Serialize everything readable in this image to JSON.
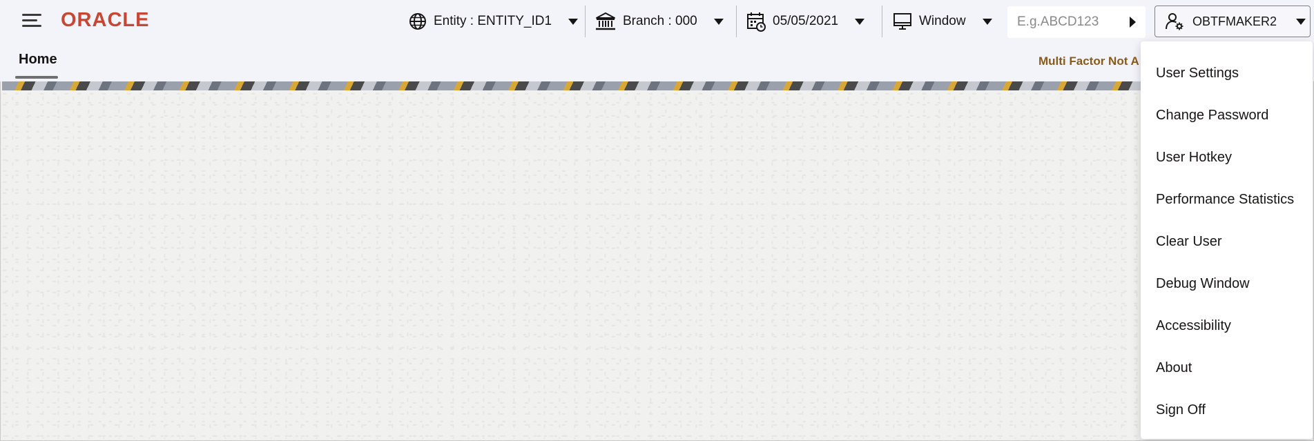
{
  "header": {
    "logo_text": "ORACLE",
    "entity_label": "Entity : ENTITY_ID1",
    "branch_label": "Branch : 000",
    "date_label": "05/05/2021",
    "window_label": "Window",
    "search_placeholder": "E.g.ABCD123",
    "user_label": "OBTFMAKER2"
  },
  "tabs": {
    "home_label": "Home",
    "mfa_notice": "Multi Factor Not A"
  },
  "user_menu": {
    "items": [
      "User Settings",
      "Change Password",
      "User Hotkey",
      "Performance Statistics",
      "Clear User",
      "Debug Window",
      "Accessibility",
      "About",
      "Sign Off"
    ]
  },
  "colors": {
    "brand_red": "#c74634",
    "header_bg": "#f3f4fa",
    "notice_text": "#8a5a18"
  },
  "icons": {
    "menu": "hamburger-icon",
    "entity": "globe-icon",
    "branch": "bank-icon",
    "date": "calendar-icon",
    "window": "monitor-icon",
    "search_go": "play-arrow-icon",
    "user": "user-settings-icon"
  }
}
